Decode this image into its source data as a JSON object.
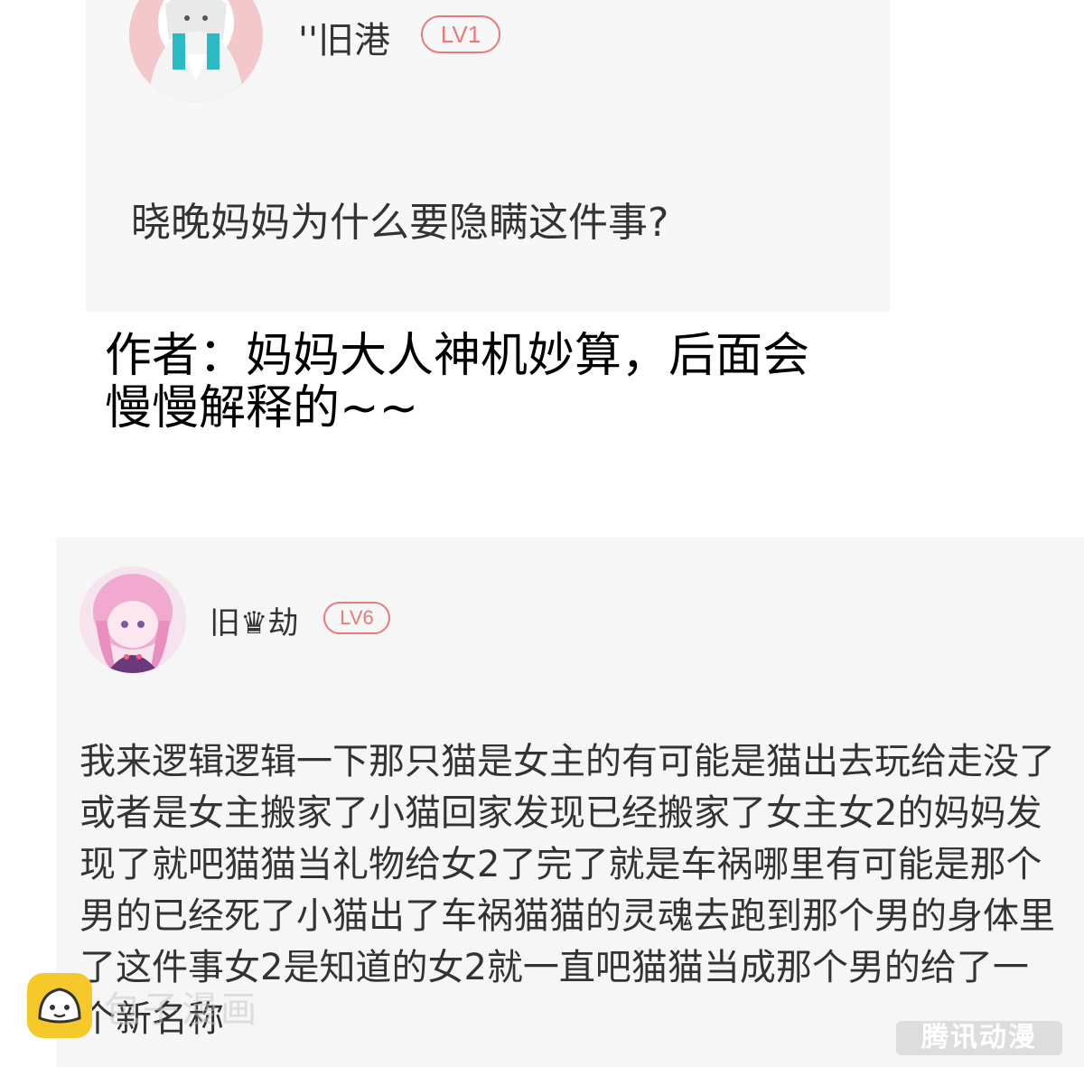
{
  "comments": [
    {
      "username": "''旧港",
      "level": "LV1",
      "text": "晓晚妈妈为什么要隐瞒这件事?",
      "avatar_icon": "anime-girl-avatar"
    },
    {
      "username": "旧♛劫",
      "level": "LV6",
      "text": "我来逻辑逻辑一下那只猫是女主的有可能是猫出去玩给走没了或者是女主搬家了小猫回家发现已经搬家了女主女2的妈妈发现了就吧猫猫当礼物给女2了完了就是车祸哪里有可能是那个男的已经死了小猫出了车祸猫猫的灵魂去跑到那个男的身体里了这件事女2是知道的女2就一直吧猫猫当成那个男的给了一个新名称",
      "avatar_icon": "pink-hair-anime-avatar"
    }
  ],
  "author_reply": {
    "line1": "作者：妈妈大人神机妙算，后面会",
    "line2": "慢慢解释的~~"
  },
  "watermarks": {
    "left_text": "包子漫画",
    "right_text": "腾讯动漫",
    "logo_icon": "bun-face-icon"
  },
  "colors": {
    "badge": "#e77a7a",
    "logo": "#f6c92a"
  }
}
